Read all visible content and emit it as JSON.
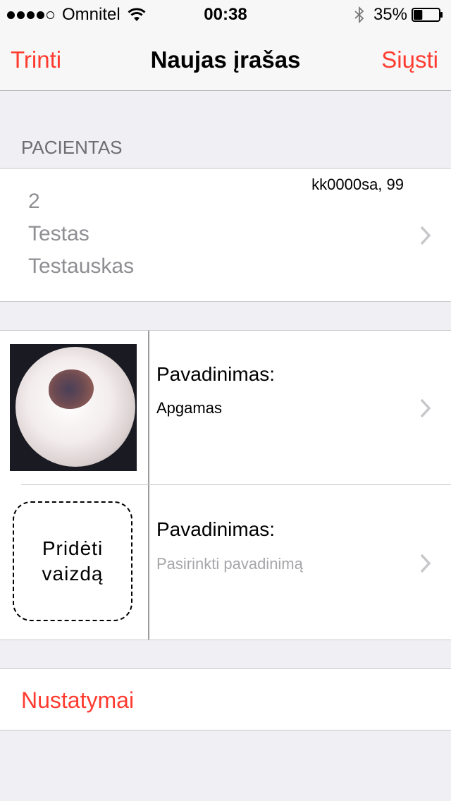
{
  "status_bar": {
    "carrier": "Omnitel",
    "time": "00:38",
    "battery_percent": "35%",
    "battery_level": 0.35,
    "signal_bars_filled": 4,
    "signal_bars_total": 5
  },
  "nav": {
    "left_label": "Trinti",
    "title": "Naujas įrašas",
    "right_label": "Siųsti"
  },
  "patient_section": {
    "header": "PACIENTAS",
    "id": "2",
    "first_name": "Testas",
    "last_name": "Testauskas",
    "code": "kk0000sa, 99"
  },
  "images": [
    {
      "name_label": "Pavadinimas:",
      "name_value": "Apgamas",
      "thumbnail_icon": "mole-photo"
    },
    {
      "name_label": "Pavadinimas:",
      "name_placeholder": "Pasirinkti pavadinimą",
      "add_label_line1": "Pridėti",
      "add_label_line2": "vaizdą"
    }
  ],
  "settings": {
    "label": "Nustatymai"
  },
  "colors": {
    "accent": "#ff3b30",
    "background": "#efeff4",
    "secondary_text": "#8e8e93",
    "placeholder_text": "#a6a6aa",
    "chevron": "#c7c7cc"
  }
}
